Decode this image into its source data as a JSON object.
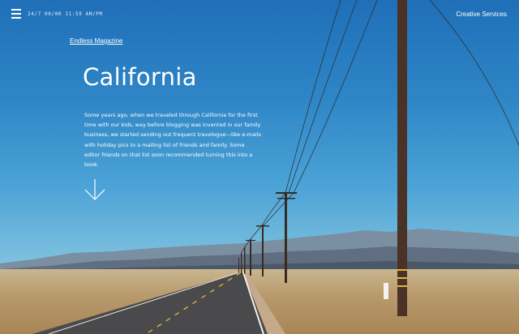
{
  "header": {
    "datetime": "24/7 00/00 11:59 AM/PM",
    "nav_link": "Creative Services"
  },
  "hero": {
    "magazine_link": "Endless Magazine",
    "title": "California",
    "intro": "Some years ago, when we traveled through California for the first time with our kids, way before blogging was invented in our family business, we started sending out frequent travelogue—like e-mails with holiday pics to a mailing list of friends and family. Some editor friends on that list soon recommended turning this into a book."
  },
  "icons": {
    "menu": "hamburger-icon",
    "scroll": "arrow-down-icon"
  },
  "colors": {
    "sky_top": "#1f6fb8",
    "sky_bottom": "#a8cfe0",
    "text": "#ffffff",
    "road": "#4a4a4c",
    "desert": "#b89a6c"
  }
}
